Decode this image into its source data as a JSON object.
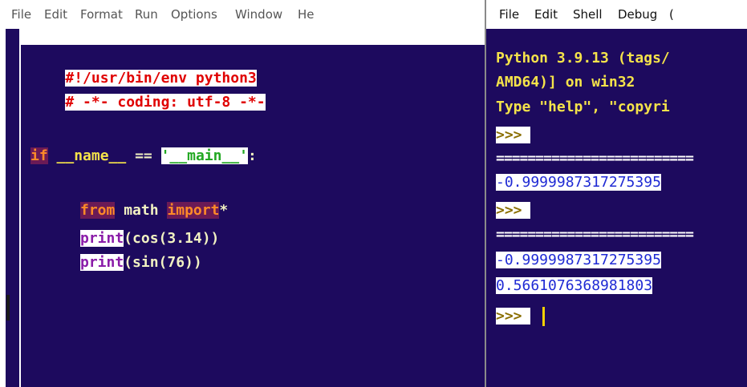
{
  "editor": {
    "menu": [
      "File",
      "Edit",
      "Format",
      "Run",
      "Options",
      "Window",
      "He"
    ],
    "lines": {
      "shebang": "#!/usr/bin/env python3",
      "coding": "# -*- coding: utf-8 -*-",
      "if_kw": "if",
      "name_dunder": "__name__",
      "eq": " == ",
      "main_str": "'__main__'",
      "colon": ":",
      "from_kw": "from",
      "math": " math ",
      "import_kw": "import",
      "star": "*",
      "print1": "print",
      "print1_args": "(cos(3.14))",
      "print2": "print",
      "print2_args": "(sin(76))"
    }
  },
  "shell": {
    "menu": [
      "File",
      "Edit",
      "Shell",
      "Debug",
      "("
    ],
    "lines": {
      "banner1": "Python 3.9.13 (tags/",
      "banner2": "AMD64)] on win32",
      "banner3": "Type \"help\", \"copyri",
      "prompt1": ">>> ",
      "separator1": "=========================",
      "result1": "-0.9999987317275395",
      "prompt2": ">>> ",
      "separator2": "=========================",
      "result2": "-0.9999987317275395",
      "result3": "0.5661076368981803",
      "prompt3": ">>> "
    }
  }
}
